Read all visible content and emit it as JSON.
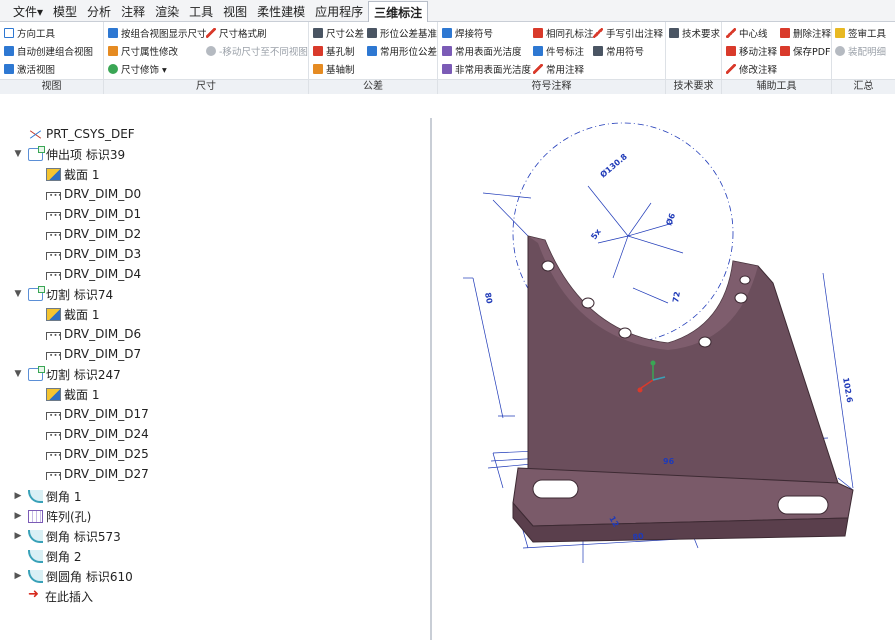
{
  "menu": [
    {
      "label": "文件▾"
    },
    {
      "label": "模型"
    },
    {
      "label": "分析"
    },
    {
      "label": "注释"
    },
    {
      "label": "渲染"
    },
    {
      "label": "工具"
    },
    {
      "label": "视图"
    },
    {
      "label": "柔性建模"
    },
    {
      "label": "应用程序"
    },
    {
      "label": "三维标注"
    }
  ],
  "ribbon": {
    "groups": {
      "view": {
        "label": "视图",
        "items": [
          "方向工具",
          "自动创建组合视图",
          "激活视图"
        ]
      },
      "dimension": {
        "label": "尺寸",
        "items": [
          "按组合视图显示尺寸",
          "尺寸格式刷",
          "尺寸属性修改",
          "-移动尺寸至不同视图",
          "尺寸修饰 ▾"
        ]
      },
      "tolerance": {
        "label": "公差",
        "items": [
          "尺寸公差",
          "形位公差基准",
          "基孔制",
          "常用形位公差",
          "基轴制"
        ]
      },
      "symbol": {
        "label": "符号注释",
        "items": [
          "焊接符号",
          "相同孔标注",
          "手写引出注释",
          "常用表面光洁度",
          "件号标注",
          "常用符号",
          "非常用表面光洁度",
          "常用注释"
        ]
      },
      "tech": {
        "label": "技术要求",
        "items": [
          "技术要求"
        ]
      },
      "aux": {
        "label": "辅助工具",
        "items": [
          "中心线",
          "删除注释",
          "移动注释",
          "保存PDF",
          "修改注释"
        ]
      },
      "summary": {
        "label": "汇总",
        "items": [
          "签审工具",
          "装配明细"
        ]
      }
    }
  },
  "tree": [
    {
      "label": "PRT_CSYS_DEF",
      "icon": "csys-icon",
      "level": 0,
      "expander": ""
    },
    {
      "label": "伸出项 标识39",
      "icon": "extrude-icon",
      "level": 0,
      "expander": "▼"
    },
    {
      "label": "截面 1",
      "icon": "section-icon",
      "level": 1,
      "expander": ""
    },
    {
      "label": "DRV_DIM_D0",
      "icon": "dimension-icon",
      "level": 1,
      "expander": ""
    },
    {
      "label": "DRV_DIM_D1",
      "icon": "dimension-icon",
      "level": 1,
      "expander": ""
    },
    {
      "label": "DRV_DIM_D2",
      "icon": "dimension-icon",
      "level": 1,
      "expander": ""
    },
    {
      "label": "DRV_DIM_D3",
      "icon": "dimension-icon",
      "level": 1,
      "expander": ""
    },
    {
      "label": "DRV_DIM_D4",
      "icon": "dimension-icon",
      "level": 1,
      "expander": ""
    },
    {
      "label": "切割 标识74",
      "icon": "cut-icon",
      "level": 0,
      "expander": "▼"
    },
    {
      "label": "截面 1",
      "icon": "section-icon",
      "level": 1,
      "expander": ""
    },
    {
      "label": "DRV_DIM_D6",
      "icon": "dimension-icon",
      "level": 1,
      "expander": ""
    },
    {
      "label": "DRV_DIM_D7",
      "icon": "dimension-icon",
      "level": 1,
      "expander": ""
    },
    {
      "label": "切割 标识247",
      "icon": "cut-icon",
      "level": 0,
      "expander": "▼"
    },
    {
      "label": "截面 1",
      "icon": "section-icon",
      "level": 1,
      "expander": ""
    },
    {
      "label": "DRV_DIM_D17",
      "icon": "dimension-icon",
      "level": 1,
      "expander": ""
    },
    {
      "label": "DRV_DIM_D24",
      "icon": "dimension-icon",
      "level": 1,
      "expander": ""
    },
    {
      "label": "DRV_DIM_D25",
      "icon": "dimension-icon",
      "level": 1,
      "expander": ""
    },
    {
      "label": "DRV_DIM_D27",
      "icon": "dimension-icon",
      "level": 1,
      "expander": ""
    },
    {
      "label": "倒角 1",
      "icon": "chamfer-icon",
      "level": 0,
      "expander": "▶"
    },
    {
      "label": "阵列(孔)",
      "icon": "pattern-icon",
      "level": 0,
      "expander": "▶"
    },
    {
      "label": "倒角 标识573",
      "icon": "chamfer-icon",
      "level": 0,
      "expander": "▶"
    },
    {
      "label": "倒角 2",
      "icon": "chamfer-icon",
      "level": 0,
      "expander": ""
    },
    {
      "label": "倒圆角 标识610",
      "icon": "round-icon",
      "level": 0,
      "expander": "▶"
    },
    {
      "label": "在此插入",
      "icon": "insert-here-icon",
      "level": 0,
      "expander": ""
    }
  ],
  "colors": {
    "part": "#6b4e5c",
    "part_top": "#8a6878",
    "dimension": "#1f3ab8",
    "active_tab": "#ffffff"
  }
}
